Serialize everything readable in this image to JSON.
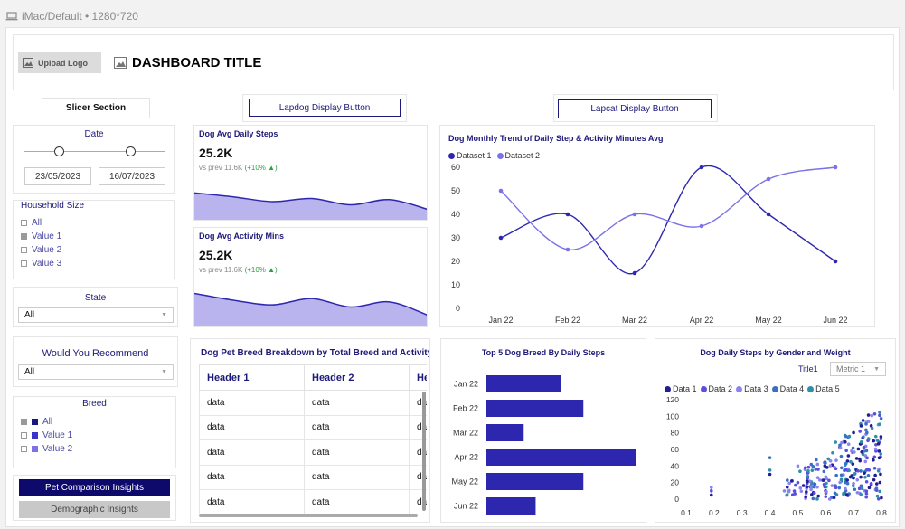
{
  "device_label": "iMac/Default • 1280*720",
  "header": {
    "upload_logo": "Upload Logo",
    "title": "DASHBOARD TITLE"
  },
  "slicer_section": "Slicer Section",
  "buttons": {
    "lapdog": "Lapdog Display Button",
    "lapcat": "Lapcat Display Button"
  },
  "date_filter": {
    "title": "Date",
    "start": "23/05/2023",
    "end": "16/07/2023"
  },
  "household": {
    "title": "Household Size",
    "items": [
      "All",
      "Value 1",
      "Value 2",
      "Value 3"
    ],
    "checked": [
      false,
      true,
      false,
      false
    ]
  },
  "state": {
    "title": "State",
    "selected": "All"
  },
  "recommend": {
    "title": "Would You Recommend",
    "selected": "All"
  },
  "breed": {
    "title": "Breed",
    "items": [
      "All",
      "Value 1",
      "Value 2"
    ],
    "checked": [
      true,
      false,
      false
    ],
    "colors": [
      "#1a1680",
      "#3b33c9",
      "#7b72e8"
    ]
  },
  "insights": {
    "pet_comparison": "Pet Comparison Insights",
    "demographic": "Demographic Insights"
  },
  "kpi_steps": {
    "title": "Dog Avg Daily Steps",
    "value": "25.2K",
    "prev": "vs prev 11.6K",
    "change": "(+10% ▲)",
    "trend": [
      0.72,
      0.62,
      0.5,
      0.58,
      0.42,
      0.55,
      0.3
    ]
  },
  "kpi_activity": {
    "title": "Dog Avg Activity Mins",
    "value": "25.2K",
    "prev": "vs prev 11.6K",
    "change": "(+10% ▲)",
    "trend": [
      0.82,
      0.66,
      0.55,
      0.7,
      0.5,
      0.62,
      0.3
    ]
  },
  "colors": {
    "primary": "#1e1a78",
    "dark": "#2d27b0",
    "light": "#7b72e8",
    "area": "#b9b4ee"
  },
  "chart_data": [
    {
      "type": "line",
      "title": "Dog Monthly Trend of Daily Step & Activity Minutes Avg",
      "categories": [
        "Jan 22",
        "Feb 22",
        "Mar 22",
        "Apr 22",
        "May 22",
        "Jun 22"
      ],
      "series": [
        {
          "name": "Dataset 1",
          "values": [
            30,
            40,
            15,
            60,
            40,
            20
          ],
          "color": "#2d27b0"
        },
        {
          "name": "Dataset 2",
          "values": [
            50,
            25,
            40,
            35,
            55,
            60
          ],
          "color": "#7b72e8"
        }
      ],
      "ylim": [
        0,
        60
      ],
      "yticks": [
        0,
        10,
        20,
        30,
        40,
        50,
        60
      ],
      "legend": "top-left"
    },
    {
      "type": "bar",
      "title": "Top 5 Dog Breed By Daily Steps",
      "orientation": "horizontal",
      "categories": [
        "Jan 22",
        "Feb 22",
        "Mar 22",
        "Apr 22",
        "May 22",
        "Jun 22"
      ],
      "values": [
        50,
        65,
        25,
        100,
        65,
        33
      ],
      "color": "#2d27b0"
    },
    {
      "type": "scatter",
      "title": "Dog Daily Steps by Gender and Weight",
      "subtitle": "Title1",
      "metric_dropdown": "Metric 1",
      "series": [
        {
          "name": "Data 1",
          "color": "#231d96"
        },
        {
          "name": "Data 2",
          "color": "#5a4fe0"
        },
        {
          "name": "Data 3",
          "color": "#8c83ee"
        },
        {
          "name": "Data 4",
          "color": "#3a6fc8"
        },
        {
          "name": "Data 5",
          "color": "#2d8fa8"
        }
      ],
      "xticks": [
        "0.1",
        "0.2",
        "0.3",
        "0.4",
        "0.5",
        "0.6",
        "0.7",
        "0.8"
      ],
      "yticks": [
        "0",
        "20",
        "40",
        "60",
        "80",
        "100",
        "120"
      ],
      "xlim": [
        0.1,
        0.8
      ],
      "ylim": [
        0,
        120
      ]
    },
    {
      "type": "table",
      "title": "Dog Pet Breed Breakdown by Total Breed and Activity",
      "headers": [
        "Header 1",
        "Header 2",
        "He"
      ],
      "rows": [
        [
          "data",
          "data",
          "da"
        ],
        [
          "data",
          "data",
          "da"
        ],
        [
          "data",
          "data",
          "da"
        ],
        [
          "data",
          "data",
          "da"
        ],
        [
          "data",
          "data",
          "da"
        ]
      ]
    }
  ]
}
